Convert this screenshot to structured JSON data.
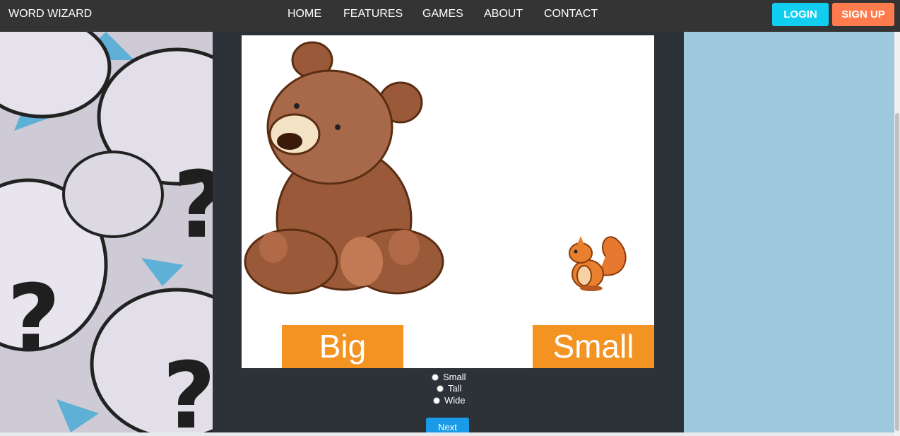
{
  "nav": {
    "brand": "WORD WIZARD",
    "links": [
      "HOME",
      "FEATURES",
      "GAMES",
      "ABOUT",
      "CONTACT"
    ],
    "login": "LOGIN",
    "signup": "SIGN UP"
  },
  "card": {
    "left_label": "Big",
    "right_label": "Small"
  },
  "options": [
    "Small",
    "Tall",
    "Wide"
  ],
  "next": "Next",
  "colors": {
    "nav": "#343434",
    "login": "#11cdf0",
    "signup": "#ff7a4d",
    "label": "#f39322",
    "next": "#1a9be8"
  }
}
